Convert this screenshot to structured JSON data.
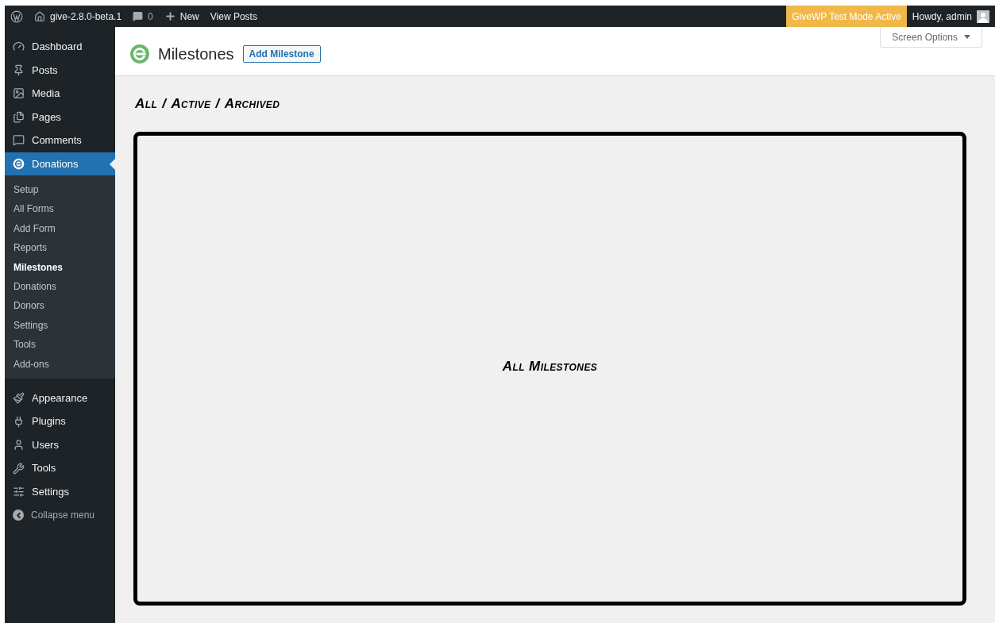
{
  "admin_bar": {
    "site": "give-2.8.0-beta.1",
    "comments": "0",
    "new": "New",
    "view_posts": "View Posts",
    "test_mode": "GiveWP Test Mode Active",
    "howdy": "Howdy, admin"
  },
  "sidebar": {
    "items": [
      {
        "label": "Dashboard",
        "selected": false
      },
      {
        "label": "Posts",
        "selected": false
      },
      {
        "label": "Media",
        "selected": false
      },
      {
        "label": "Pages",
        "selected": false
      },
      {
        "label": "Comments",
        "selected": false
      },
      {
        "label": "Donations",
        "selected": true,
        "children": [
          {
            "label": "Setup",
            "selected": false
          },
          {
            "label": "All Forms",
            "selected": false
          },
          {
            "label": "Add Form",
            "selected": false
          },
          {
            "label": "Reports",
            "selected": false
          },
          {
            "label": "Milestones",
            "selected": true
          },
          {
            "label": "Donations",
            "selected": false
          },
          {
            "label": "Donors",
            "selected": false
          },
          {
            "label": "Settings",
            "selected": false
          },
          {
            "label": "Tools",
            "selected": false
          },
          {
            "label": "Add-ons",
            "selected": false
          }
        ]
      },
      {
        "label": "Appearance",
        "selected": false
      },
      {
        "label": "Plugins",
        "selected": false
      },
      {
        "label": "Users",
        "selected": false
      },
      {
        "label": "Tools",
        "selected": false
      },
      {
        "label": "Settings",
        "selected": false
      }
    ],
    "collapse": "Collapse menu"
  },
  "header": {
    "title": "Milestones",
    "add_button": "Add Milestone",
    "screen_options": "Screen Options"
  },
  "filters": {
    "items": [
      "All",
      "Active",
      "Archived"
    ],
    "separator": "/"
  },
  "panel": {
    "label": "All Milestones"
  }
}
